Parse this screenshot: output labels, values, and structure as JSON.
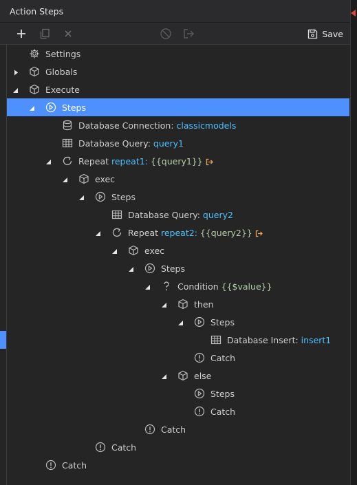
{
  "panel": {
    "title": "Action Steps"
  },
  "toolbar": {
    "add_icon": "plus-icon",
    "copy_icon": "copy-icon",
    "delete_icon": "close-icon",
    "disable_icon": "disable-icon",
    "export_icon": "export-icon",
    "save_label": "Save",
    "save_icon": "floppy-disk-icon"
  },
  "colors": {
    "background": "#252526",
    "selection": "#4d90fe",
    "value_blue": "#4fc1ff",
    "value_green": "#b5cea8",
    "exit_icon": "#e8a25a"
  },
  "tree": {
    "settings": "Settings",
    "globals": "Globals",
    "execute": "Execute",
    "steps": "Steps",
    "db_connection": {
      "label": "Database Connection:",
      "value": "classicmodels"
    },
    "db_query1": {
      "label": "Database Query:",
      "value": "query1"
    },
    "repeat1": {
      "label": "Repeat",
      "name": "repeat1:",
      "expr": "{{query1}}"
    },
    "exec1": "exec",
    "steps2": "Steps",
    "db_query2": {
      "label": "Database Query:",
      "value": "query2"
    },
    "repeat2": {
      "label": "Repeat",
      "name": "repeat2:",
      "expr": "{{query2}}"
    },
    "exec2": "exec",
    "steps3": "Steps",
    "condition": {
      "label": "Condition",
      "expr": "{{$value}}"
    },
    "then": "then",
    "steps4": "Steps",
    "db_insert": {
      "label": "Database Insert:",
      "value": "insert1"
    },
    "catch_then": "Catch",
    "else": "else",
    "steps_else": "Steps",
    "catch_else": "Catch",
    "catch_exec2": "Catch",
    "catch_exec1": "Catch",
    "catch_root": "Catch"
  }
}
